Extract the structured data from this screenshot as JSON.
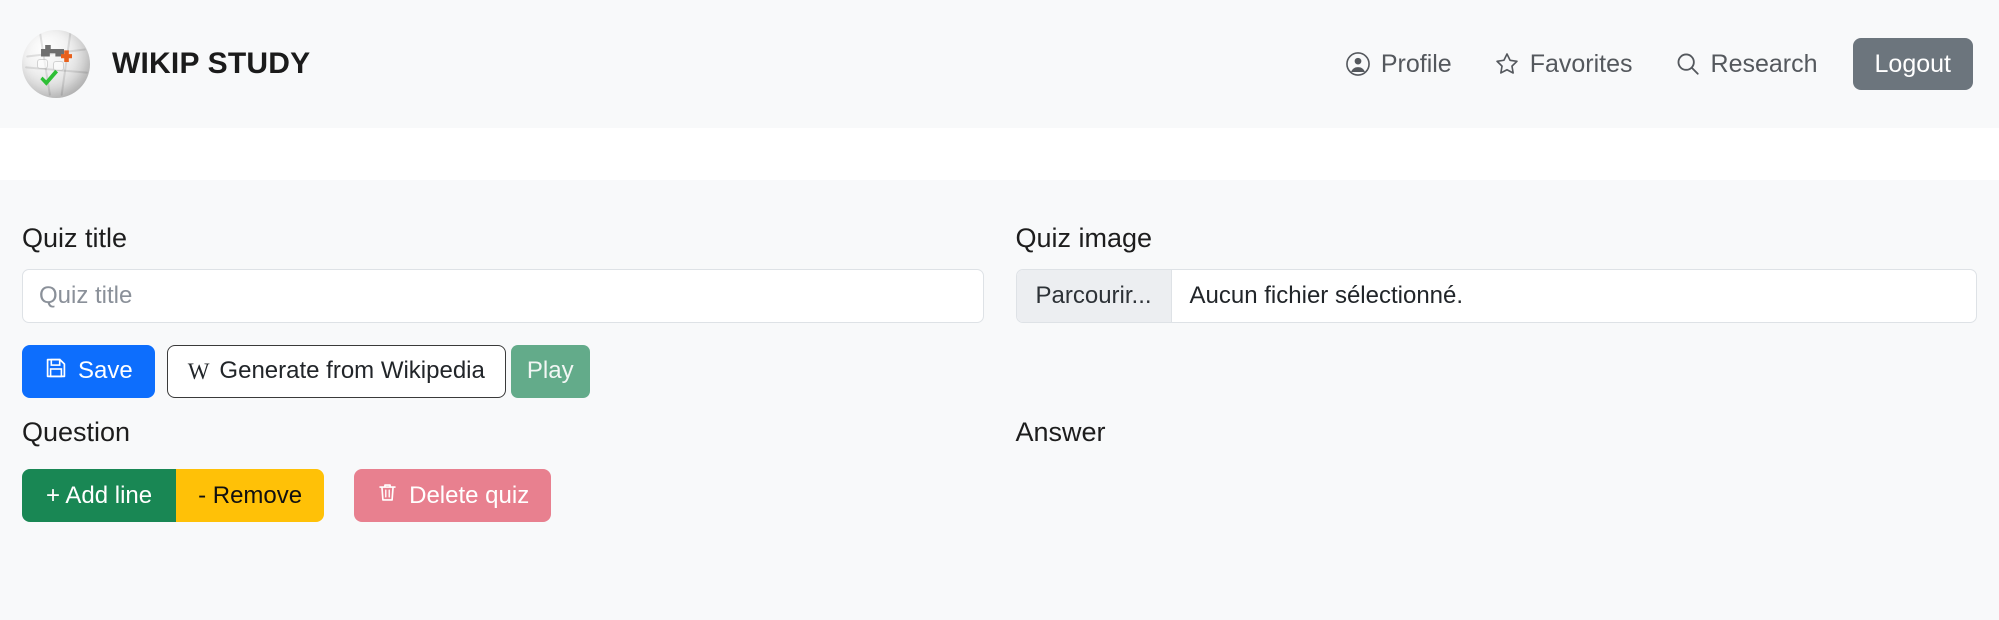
{
  "navbar": {
    "logo_icon": "wikipedia-globe-icon",
    "brand": "WIKIP STUDY",
    "links": [
      {
        "icon": "profile-icon",
        "label": "Profile"
      },
      {
        "icon": "star-icon",
        "label": "Favorites"
      },
      {
        "icon": "search-icon",
        "label": "Research"
      }
    ],
    "logout_label": "Logout"
  },
  "form": {
    "quiz_title": {
      "label": "Quiz title",
      "value": "",
      "placeholder": "Quiz title"
    },
    "quiz_image": {
      "label": "Quiz image",
      "browse_label": "Parcourir...",
      "file_status": "Aucun fichier sélectionné."
    },
    "actions": {
      "save_label": "Save",
      "save_icon": "floppy-disk-icon",
      "generate_label": "Generate from Wikipedia",
      "generate_icon": "wikipedia-w-icon",
      "generate_w": "W",
      "play_label": "Play"
    },
    "question_label": "Question",
    "answer_label": "Answer",
    "line_actions": {
      "add_label": "+ Add line",
      "remove_label": "- Remove",
      "delete_label": "Delete quiz",
      "delete_icon": "trash-icon"
    }
  },
  "colors": {
    "page_bg": "#f8f9fa",
    "navbar_bg": "#f8f9fa",
    "white_band": "#ffffff",
    "primary": "#0d6efd",
    "secondary": "#6c757d",
    "success": "#198754",
    "warning": "#ffc107",
    "danger_soft": "#e8808f",
    "play_green": "#63ab8a",
    "border": "#dee2e6",
    "text": "#212529",
    "muted": "#54585d"
  }
}
